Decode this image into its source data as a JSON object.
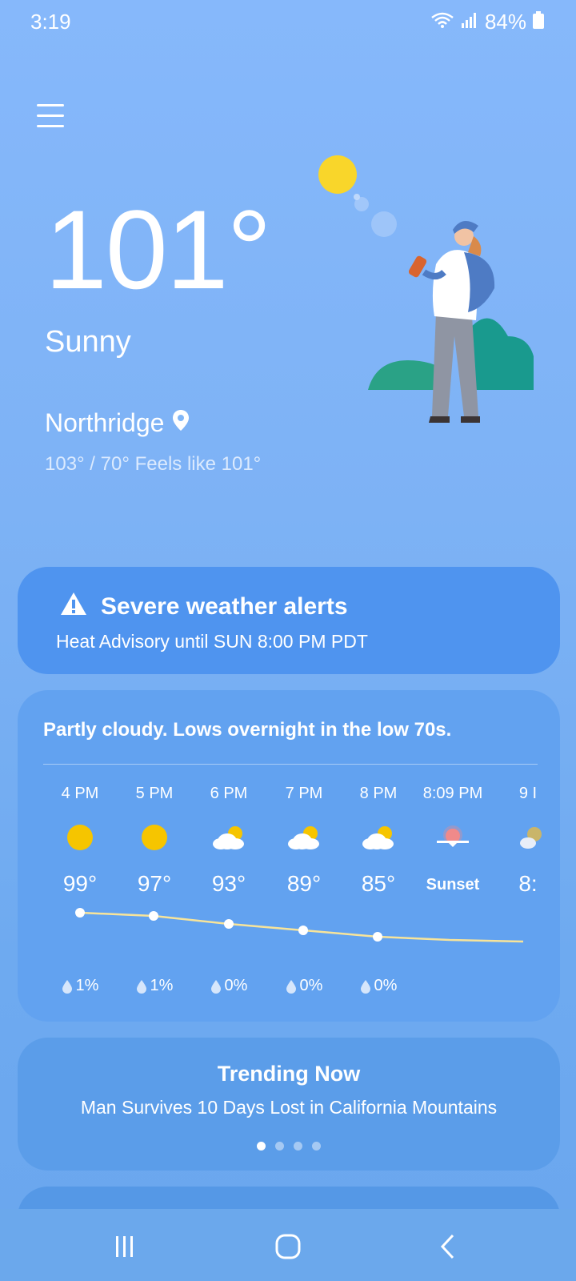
{
  "status_bar": {
    "time": "3:19",
    "battery": "84%"
  },
  "current": {
    "temperature": "101°",
    "condition": "Sunny",
    "location": "Northridge",
    "hi_lo_feels": "103° / 70° Feels like 101°"
  },
  "alert": {
    "title": "Severe weather alerts",
    "detail": "Heat Advisory until SUN 8:00 PM PDT"
  },
  "forecast": {
    "summary": "Partly cloudy. Lows overnight in the low 70s.",
    "hours": [
      {
        "time": "4 PM",
        "icon": "sun-icon",
        "temp": "99°",
        "precip": "1%"
      },
      {
        "time": "5 PM",
        "icon": "sun-icon",
        "temp": "97°",
        "precip": "1%"
      },
      {
        "time": "6 PM",
        "icon": "partly-cloudy-icon",
        "temp": "93°",
        "precip": "0%"
      },
      {
        "time": "7 PM",
        "icon": "partly-cloudy-icon",
        "temp": "89°",
        "precip": "0%"
      },
      {
        "time": "8 PM",
        "icon": "partly-cloudy-icon",
        "temp": "85°",
        "precip": "0%"
      },
      {
        "time": "8:09 PM",
        "icon": "sunset-icon",
        "temp": "Sunset",
        "precip": ""
      },
      {
        "time": "9 I",
        "icon": "partly-cloudy-night-icon",
        "temp": "8:",
        "precip": ""
      }
    ]
  },
  "trending": {
    "title": "Trending Now",
    "headline": "Man Survives 10 Days Lost in California Mountains",
    "pages": 4,
    "active_page": 1
  },
  "colors": {
    "sun": "#f6c500",
    "alert_bg": "#4f94ef",
    "card_bg": "#62a2f0",
    "sunset": "#f08a8a"
  }
}
